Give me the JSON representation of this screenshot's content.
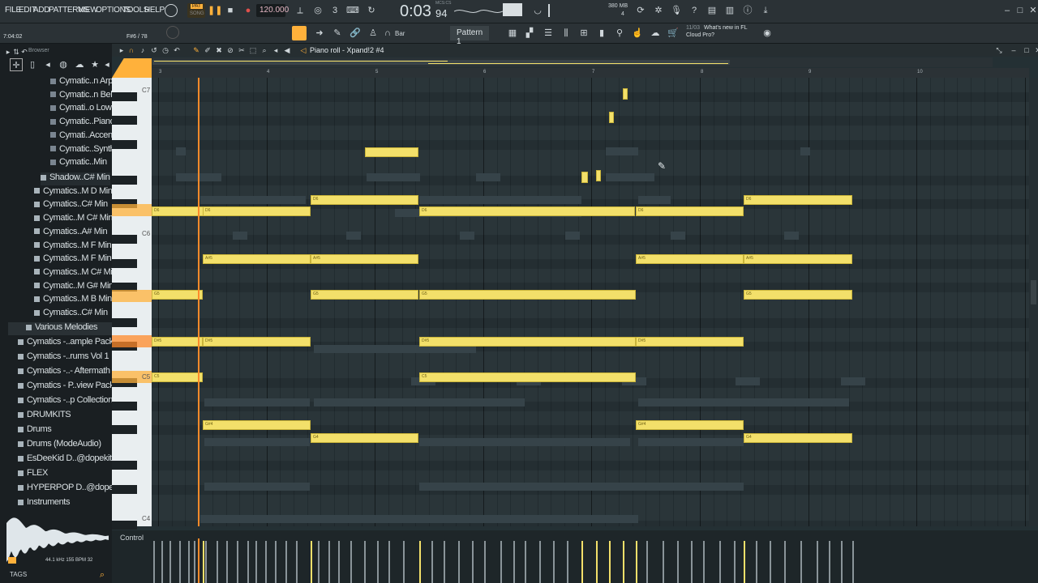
{
  "menu": {
    "file": "FILE",
    "edit": "EDIT",
    "add": "ADD",
    "patterns": "PATTERNS",
    "view": "VIEW",
    "options": "OPTIONS",
    "tools": "TOOLS",
    "help": "HELP"
  },
  "transport": {
    "tempo": "120.000",
    "time": "0:03",
    "time_frac": "94",
    "time_label": "MCS:CS",
    "mem": "380 MB",
    "voices": "4",
    "pat_label": "PAT",
    "song_label": "SONG"
  },
  "status": {
    "position": "7:04:02",
    "key_hint": "F#6 / 78",
    "snap": "Bar",
    "pattern": "Pattern 1",
    "news_date": "11/03",
    "news_text": "What's new in FL",
    "news_text2": "Cloud Pro?"
  },
  "browser": {
    "title": "Browser",
    "items": [
      "Cymatic..n Arp",
      "Cymatic..n Bell",
      "Cymati..o Low",
      "Cymatic..Piano",
      "Cymati..Accent",
      "Cymatic..Synth",
      "Cymatic..Min",
      "Shadow..C# Min",
      "Cymatics..M D Min",
      "Cymatics..C# Min",
      "Cymatic..M C# Min",
      "Cymatics..A# Min",
      "Cymatics..M F Min",
      "Cymatics..M F Min",
      "Cymatics..M C# Min",
      "Cymatic..M G# Min",
      "Cymatics..M B Min",
      "Cymatics..C# Min",
      "Various Melodies",
      "Cymatics -..ample Pack",
      "Cymatics -..rums Vol 1",
      "Cymatics -..- Aftermath",
      "Cymatics - P..view Pack",
      "Cymatics -..p Collection",
      "DRUMKITS",
      "Drums",
      "Drums (ModeAudio)",
      "EsDeeKid D..@dopekit",
      "FLEX",
      "HYPERPOP D..@dopekit",
      "Instruments"
    ],
    "waveform_info": "44.1 kHz 155 BPM 32",
    "tags": "TAGS"
  },
  "pianoroll": {
    "title": "Piano roll - Xpand!2 #4",
    "bars": [
      "3",
      "4",
      "5",
      "6",
      "7",
      "8",
      "9",
      "10"
    ],
    "key_labels": [
      "C7",
      "C6",
      "C5",
      "C4"
    ],
    "control": "Control",
    "note_labels": [
      "D6",
      "A#5",
      "G5",
      "D#5",
      "C5",
      "G#4",
      "G4"
    ],
    "colors": {
      "note": "#f3e06a",
      "playhead": "#ff8a2a",
      "accent": "#ffb13b"
    }
  }
}
